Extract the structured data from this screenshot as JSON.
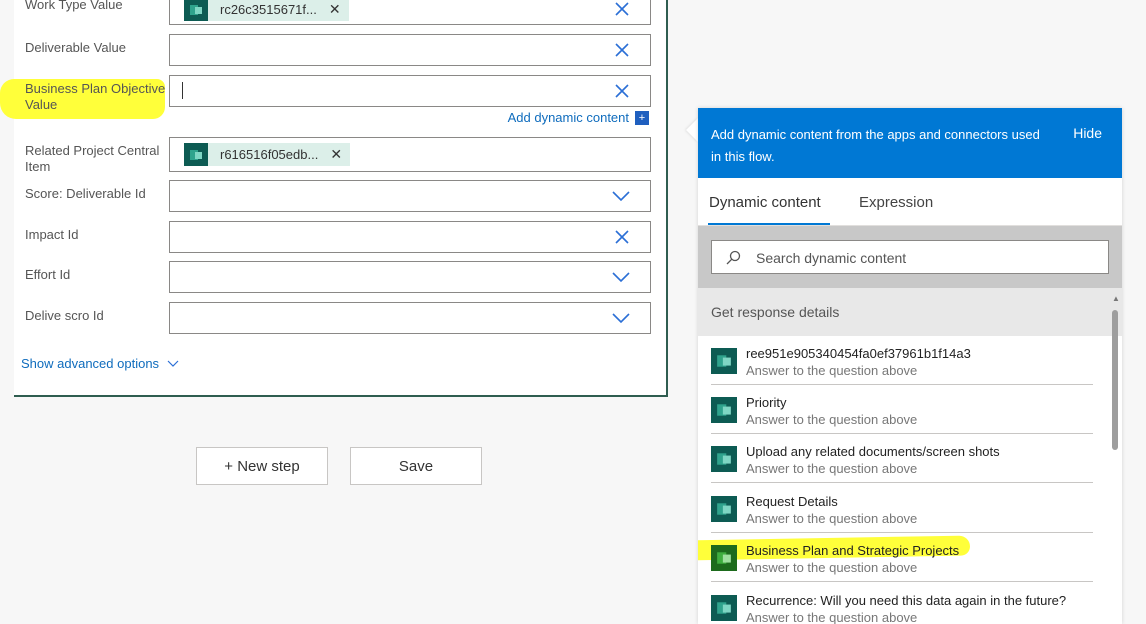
{
  "form": {
    "fields": [
      {
        "label": "Work Type Value",
        "token": "rc26c3515671f...",
        "control": "clear"
      },
      {
        "label": "Deliverable Value",
        "control": "clear"
      },
      {
        "label": "Business Plan Objective Value",
        "control": "clear"
      },
      {
        "label": "Related Project Central Item",
        "token": "r616516f05edb...",
        "control": "none"
      },
      {
        "label": "Score: Deliverable Id",
        "control": "dropdown"
      },
      {
        "label": "Impact Id",
        "control": "clear"
      },
      {
        "label": "Effort Id",
        "control": "dropdown"
      },
      {
        "label": "Delive scro Id",
        "control": "dropdown"
      }
    ],
    "add_dynamic_content": "Add dynamic content",
    "show_advanced": "Show advanced options"
  },
  "buttons": {
    "new_step": "+ New step",
    "save": "Save"
  },
  "panel": {
    "message": "Add dynamic content from the apps and connectors used in this flow.",
    "hide": "Hide",
    "tabs": [
      "Dynamic content",
      "Expression"
    ],
    "search_placeholder": "Search dynamic content",
    "section": "Get response details",
    "items": [
      {
        "title": "ree951e905340454fa0ef37961b1f14a3",
        "subtitle": "Answer to the question above"
      },
      {
        "title": "Priority",
        "subtitle": "Answer to the question above"
      },
      {
        "title": "Upload any related documents/screen shots",
        "subtitle": "Answer to the question above"
      },
      {
        "title": "Request Details",
        "subtitle": "Answer to the question above"
      },
      {
        "title": "Business Plan and Strategic Projects",
        "subtitle": "Answer to the question above"
      },
      {
        "title": "Recurrence: Will you need this data again in the future?",
        "subtitle": "Answer to the question above"
      }
    ]
  },
  "colors": {
    "accent": "#0078d4",
    "highlight": "#ffff3a",
    "forms_icon": "#0d5b53"
  },
  "icons": [
    "forms-icon",
    "close-icon",
    "chevron-down-icon",
    "search-icon",
    "plus-icon"
  ]
}
